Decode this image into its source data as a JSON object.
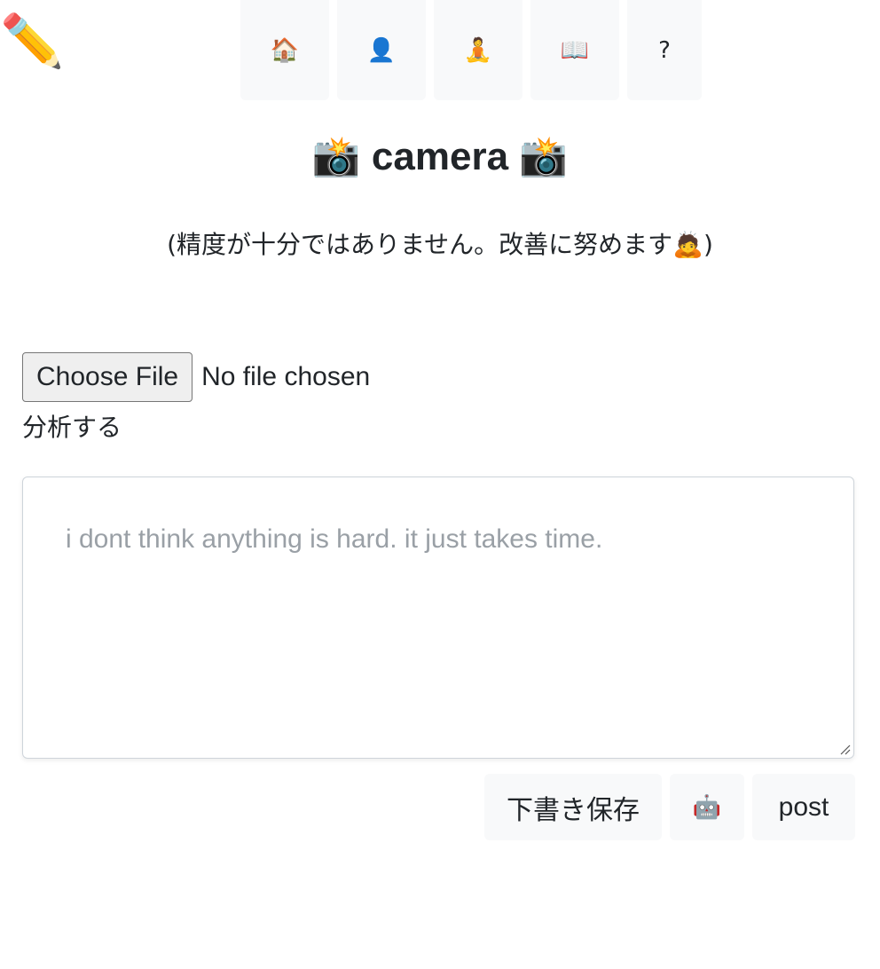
{
  "logo": {
    "icon": "pencil-icon",
    "glyph": "✏️"
  },
  "nav": {
    "items": [
      {
        "icon": "house-icon",
        "glyph": "🏠"
      },
      {
        "icon": "user-icon",
        "glyph": "👤"
      },
      {
        "icon": "meditation-icon",
        "glyph": "🧘"
      },
      {
        "icon": "book-icon",
        "glyph": "📖"
      },
      {
        "icon": "question-icon",
        "glyph": "?"
      }
    ]
  },
  "page": {
    "title": "📸 camera 📸",
    "notice": "(精度が十分ではありません。改善に努めます🙇)"
  },
  "file_input": {
    "button_label": "Choose File",
    "status": "No file chosen"
  },
  "analyze_label": "分析する",
  "editor": {
    "placeholder": "i dont think anything is hard. it just takes time."
  },
  "actions": {
    "draft_label": "下書き保存",
    "robot": {
      "icon": "robot-icon",
      "glyph": "🤖"
    },
    "post_label": "post"
  },
  "colors": {
    "button_bg": "#f8f9fa",
    "placeholder": "#9aa0a6",
    "border": "#ced4da"
  }
}
